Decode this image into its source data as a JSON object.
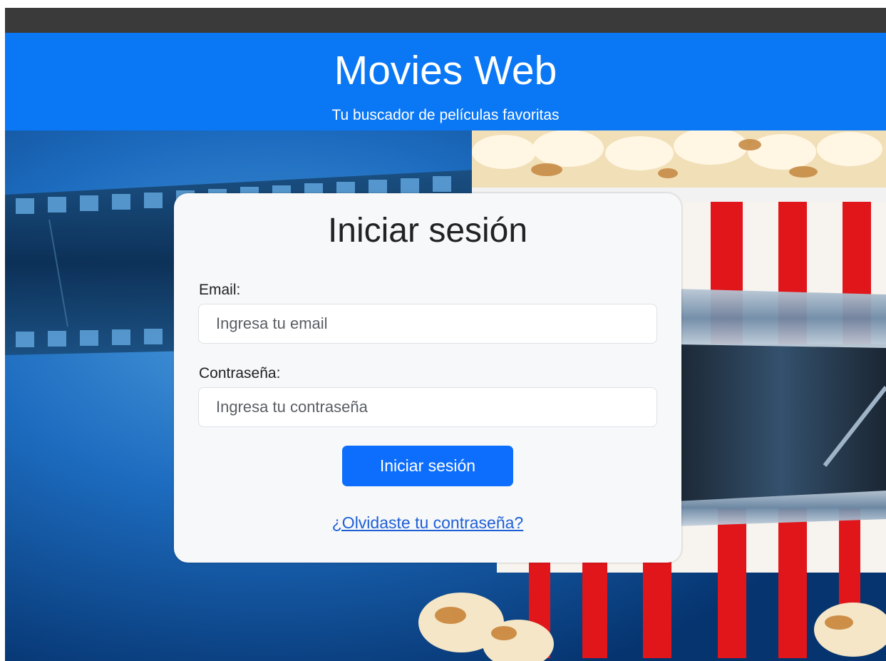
{
  "header": {
    "title": "Movies Web",
    "subtitle": "Tu buscador de películas favoritas"
  },
  "login": {
    "title": "Iniciar sesión",
    "email_label": "Email:",
    "email_placeholder": "Ingresa tu email",
    "email_value": "",
    "password_label": "Contraseña:",
    "password_placeholder": "Ingresa tu contraseña",
    "password_value": "",
    "submit_label": "Iniciar sesión",
    "forgot_label": "¿Olvidaste tu contraseña?"
  },
  "colors": {
    "header_bg": "#0a77f5",
    "topbar_bg": "#3a3a3a",
    "card_bg": "#f6f8fa",
    "button_bg": "#0d6efd",
    "link": "#1f5fd6"
  }
}
